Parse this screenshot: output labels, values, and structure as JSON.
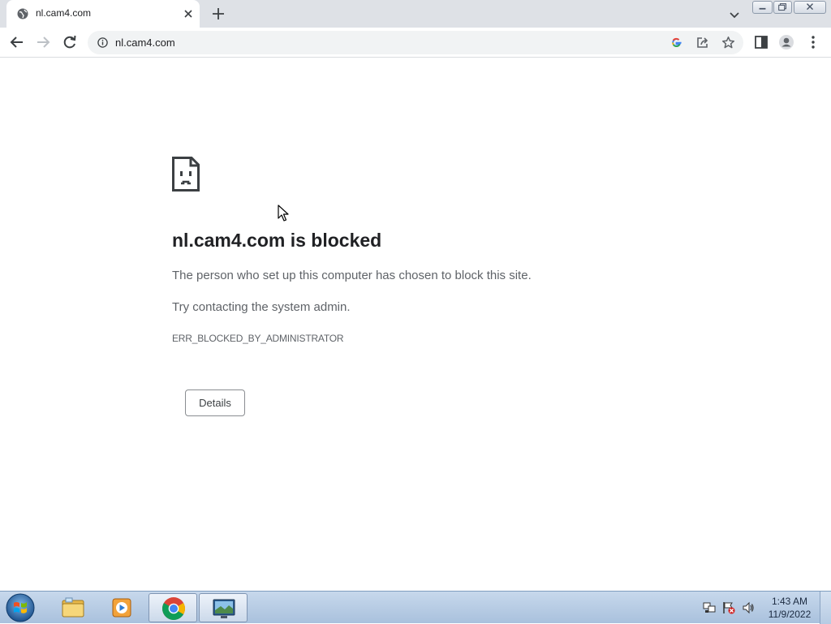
{
  "tab": {
    "title": "nl.cam4.com"
  },
  "omnibox": {
    "url": "nl.cam4.com"
  },
  "error": {
    "title": "nl.cam4.com is blocked",
    "description": "The person who set up this computer has chosen to block this site.",
    "hint": "Try contacting the system admin.",
    "code": "ERR_BLOCKED_BY_ADMINISTRATOR",
    "details_label": "Details"
  },
  "taskbar": {
    "time": "1:43 AM",
    "date": "11/9/2022",
    "items": [
      "file-explorer-icon",
      "media-player-icon",
      "chrome-icon",
      "display-settings-icon"
    ]
  },
  "colors": {
    "tab_strip": "#dee1e6",
    "omnibox": "#f1f3f4",
    "title_text": "#202124",
    "body_text": "#5f6368"
  }
}
